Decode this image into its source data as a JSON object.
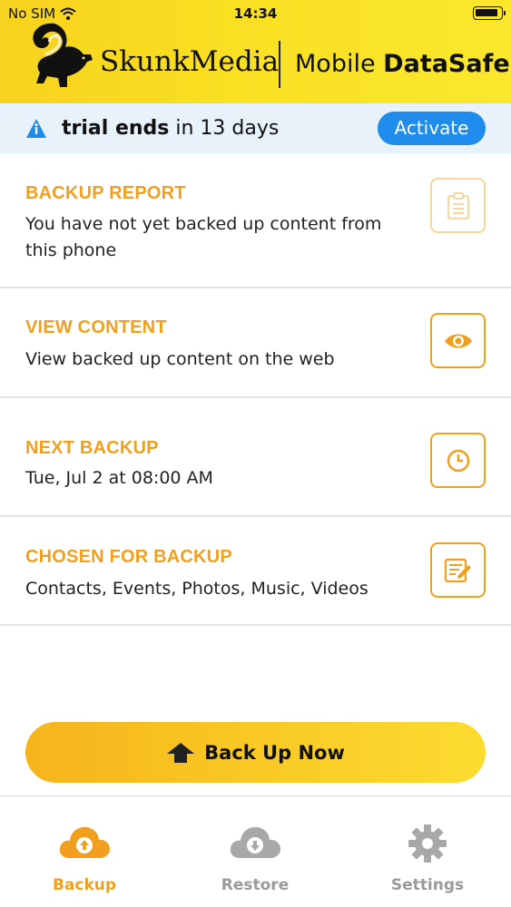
{
  "status_bar": {
    "carrier": "No SIM",
    "time": "14:34"
  },
  "header": {
    "brand": "SkunkMedia",
    "product_light": "Mobile ",
    "product_bold": "DataSafe"
  },
  "trial": {
    "text_bold": "trial ends",
    "text_rest": " in 13 days",
    "activate_label": "Activate"
  },
  "items": [
    {
      "title": "BACKUP REPORT",
      "desc": "You have not yet backed up content from this phone",
      "icon": "clipboard-icon"
    },
    {
      "title": "VIEW CONTENT",
      "desc": "View backed up content on the web",
      "icon": "eye-icon"
    },
    {
      "title": "NEXT BACKUP",
      "desc": "Tue, Jul 2 at 08:00 AM",
      "icon": "clock-icon"
    },
    {
      "title": "CHOSEN FOR BACKUP",
      "desc": "Contacts, Events, Photos, Music, Videos",
      "icon": "edit-list-icon"
    }
  ],
  "backup_now": {
    "label": "Back Up Now"
  },
  "tabs": [
    {
      "label": "Backup",
      "icon": "cloud-upload-icon",
      "active": true
    },
    {
      "label": "Restore",
      "icon": "cloud-download-icon",
      "active": false
    },
    {
      "label": "Settings",
      "icon": "gear-icon",
      "active": false
    }
  ],
  "colors": {
    "accent": "#f0a01e",
    "header_yellow": "#f9e023",
    "activate_blue": "#1f8bea",
    "trial_bg": "#e8f2fb"
  }
}
